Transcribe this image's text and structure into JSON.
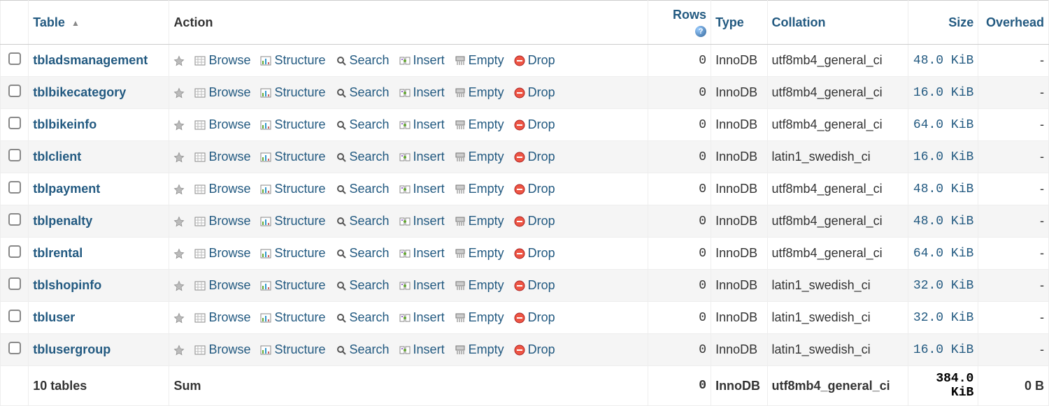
{
  "headers": {
    "table": "Table",
    "action": "Action",
    "rows": "Rows",
    "type": "Type",
    "collation": "Collation",
    "size": "Size",
    "overhead": "Overhead"
  },
  "actions": {
    "browse": "Browse",
    "structure": "Structure",
    "search": "Search",
    "insert": "Insert",
    "empty": "Empty",
    "drop": "Drop"
  },
  "tables": [
    {
      "name": "tbladsmanagement",
      "rows": "0",
      "type": "InnoDB",
      "collation": "utf8mb4_general_ci",
      "size": "48.0 KiB",
      "overhead": "-"
    },
    {
      "name": "tblbikecategory",
      "rows": "0",
      "type": "InnoDB",
      "collation": "utf8mb4_general_ci",
      "size": "16.0 KiB",
      "overhead": "-"
    },
    {
      "name": "tblbikeinfo",
      "rows": "0",
      "type": "InnoDB",
      "collation": "utf8mb4_general_ci",
      "size": "64.0 KiB",
      "overhead": "-"
    },
    {
      "name": "tblclient",
      "rows": "0",
      "type": "InnoDB",
      "collation": "latin1_swedish_ci",
      "size": "16.0 KiB",
      "overhead": "-"
    },
    {
      "name": "tblpayment",
      "rows": "0",
      "type": "InnoDB",
      "collation": "utf8mb4_general_ci",
      "size": "48.0 KiB",
      "overhead": "-"
    },
    {
      "name": "tblpenalty",
      "rows": "0",
      "type": "InnoDB",
      "collation": "utf8mb4_general_ci",
      "size": "48.0 KiB",
      "overhead": "-"
    },
    {
      "name": "tblrental",
      "rows": "0",
      "type": "InnoDB",
      "collation": "utf8mb4_general_ci",
      "size": "64.0 KiB",
      "overhead": "-"
    },
    {
      "name": "tblshopinfo",
      "rows": "0",
      "type": "InnoDB",
      "collation": "latin1_swedish_ci",
      "size": "32.0 KiB",
      "overhead": "-"
    },
    {
      "name": "tbluser",
      "rows": "0",
      "type": "InnoDB",
      "collation": "latin1_swedish_ci",
      "size": "32.0 KiB",
      "overhead": "-"
    },
    {
      "name": "tblusergroup",
      "rows": "0",
      "type": "InnoDB",
      "collation": "latin1_swedish_ci",
      "size": "16.0 KiB",
      "overhead": "-"
    }
  ],
  "summary": {
    "count_label": "10 tables",
    "sum_label": "Sum",
    "rows": "0",
    "type": "InnoDB",
    "collation": "utf8mb4_general_ci",
    "size": "384.0 KiB",
    "overhead": "0 B"
  }
}
